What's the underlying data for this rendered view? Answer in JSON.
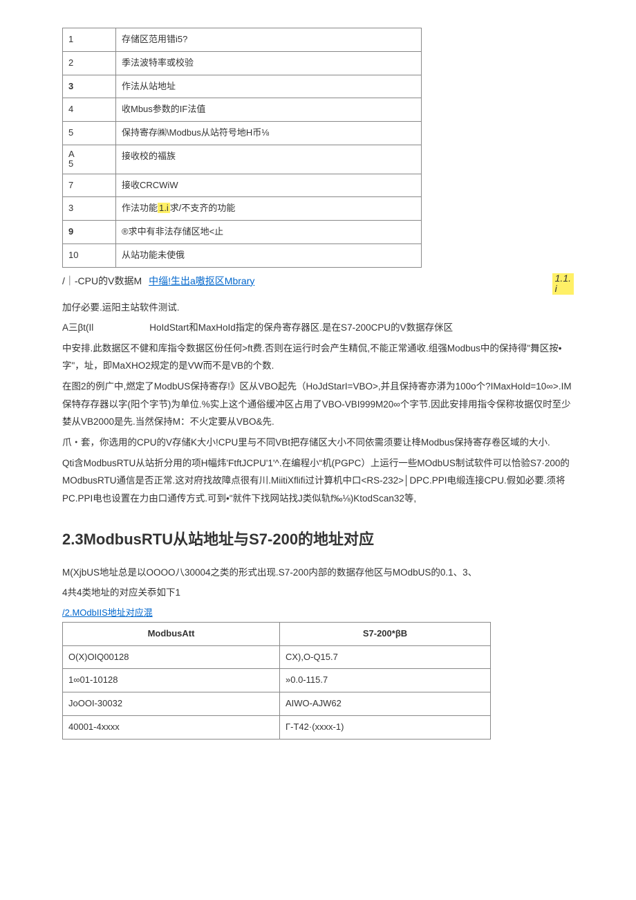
{
  "table1": {
    "rows": [
      {
        "code": "1",
        "desc": "存储区范用错i5?"
      },
      {
        "code": "2",
        "desc": "季法波特率或校验"
      },
      {
        "code": "3",
        "desc": "作法从站地址",
        "bold_code": true
      },
      {
        "code": "4",
        "desc": "收Mbus参数的IF法值"
      },
      {
        "code": "5",
        "desc": "保持寄存㈱\\Modbus从站符号地H币⅛"
      },
      {
        "code": "A\n5",
        "desc": "接收校的福族"
      },
      {
        "code": "7",
        "desc": "接收CRCWiW"
      },
      {
        "code": "3",
        "desc": "作法功能",
        "desc_hl": "1.i",
        "desc_tail": "求/不支齐的功能"
      },
      {
        "code": "9",
        "desc": "®求中有非法存储区地<止",
        "bold_code": true
      },
      {
        "code": "10",
        "desc": "从站功能未使俄"
      }
    ]
  },
  "note": {
    "line1_a": "/｜-CPU的V数据M",
    "line1_link": "中缁!生出a嗷抠区Mbrary",
    "line1_num": "1.1.\ni"
  },
  "body": {
    "p1": "加仔必要.运阳主站软件测试.",
    "p2": "A三βt(Il      HoIdStart和MaxHoId指定的保舟寄存器区.是在S7-200CPU的V数据存侎区",
    "p3": "中安排.此数据区不健和库指令数据区份任何>ft费.否则在运行时会产生精侃,不能正常通收.组强Modbus中的保持得\"舞区按•字\"，址，即MaXHO2规定的是VW而不是VB的个数.",
    "p4": "在图2的例广中,燃定了ModbUS保持寄存!》区从VBO起先（HoJdStarI=VBO>,并且保持寄亦漭为100o个?IMaxHoId=10∞>.IM保特存存器以字(阳个字节)为单位.%实上这个通俗缓冲区占用了VBO-VBI999M20∞个字节.因此安排用指令保称妆据仅时至少婪从VB2000是先.当然保持M：不火定要从VBO&先.",
    "p5": "爪・套，你选用的CPU的V存储K大小!CPU里与不同VBt把存储区大小不同依需须要让栙Modbus保持寄存卷区域的大小.",
    "p6": "Qti含ModbusRTU从站折分用的项H幅炜'FtftJCPU'1'^.在编程小“机(PGPC）上运行一些MOdbUS制试软件可以恰验S7·200的MOdbusRTU通信是否正常.这对府找故障点很有川.MiitiXflifi过计算机中口<RS-232>│DPC.PPI电缎连接CPU.假如必要.须将PC.PPI电也设置在力由口通传方式.可到•\"就件下找网站找J类似轨f‰⅛)KtodScan32等,"
  },
  "section": {
    "title": "2.3ModbusRTU从站地址与S7-200的地址对应"
  },
  "body2": {
    "p1": "M(XjbUS地址总是以OOOO八30004之类的形式出现.S7-200内部的数据存他区与MOdbUS的0.1、3、",
    "p2": "4共4类地址的对应关忝如下1"
  },
  "table2": {
    "caption": "/2.MOdbIIS地址对应混",
    "headers": {
      "h1": "ModbusAtt",
      "h2": "S7-200*βB"
    },
    "rows": [
      {
        "c1": "O(X)OIQ00128",
        "c2": "CX),O-Q15.7"
      },
      {
        "c1": "1∞01-10128",
        "c2": "»0.0-115.7"
      },
      {
        "c1": "JoOOI-30032",
        "c2": "AIWO-AJW62"
      },
      {
        "c1": "40001-4xxxx",
        "c2": "Γ-T42·(xxxx-1)"
      }
    ]
  }
}
